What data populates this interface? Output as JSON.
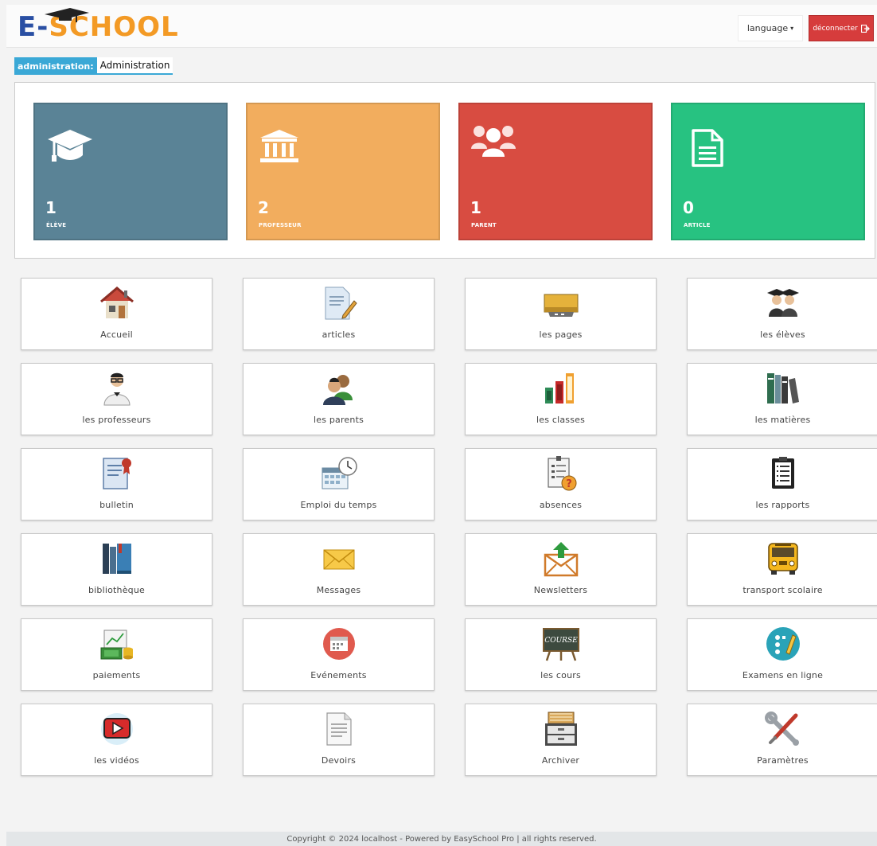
{
  "header": {
    "logo_e": "E-",
    "logo_rest": "SCHOOL",
    "language_label": "language",
    "logout_label": "déconnecter"
  },
  "breadcrumb": {
    "tag": "administration:",
    "current": "Administration"
  },
  "stats": [
    {
      "value": "1",
      "label": "ÉLÈVE",
      "color": "#5a8396",
      "icon": "graduation-cap-icon"
    },
    {
      "value": "2",
      "label": "PROFESSEUR",
      "color": "#f2ad5e",
      "icon": "institution-icon"
    },
    {
      "value": "1",
      "label": "PARENT",
      "color": "#d84c41",
      "icon": "users-icon"
    },
    {
      "value": "0",
      "label": "ARTICLE",
      "color": "#27c281",
      "icon": "document-icon"
    }
  ],
  "tiles": [
    {
      "label": "Accueil",
      "icon": "home-icon"
    },
    {
      "label": "articles",
      "icon": "article-icon"
    },
    {
      "label": "les pages",
      "icon": "pages-icon"
    },
    {
      "label": "les élèves",
      "icon": "students-icon"
    },
    {
      "label": "les professeurs",
      "icon": "teacher-icon"
    },
    {
      "label": "les parents",
      "icon": "parents-icon"
    },
    {
      "label": "les classes",
      "icon": "classes-icon"
    },
    {
      "label": "les matières",
      "icon": "subjects-icon"
    },
    {
      "label": "bulletin",
      "icon": "certificate-icon"
    },
    {
      "label": "Emploi du temps",
      "icon": "schedule-icon"
    },
    {
      "label": "absences",
      "icon": "absences-icon"
    },
    {
      "label": "les rapports",
      "icon": "reports-icon"
    },
    {
      "label": "bibliothèque",
      "icon": "library-icon"
    },
    {
      "label": "Messages",
      "icon": "envelope-icon"
    },
    {
      "label": "Newsletters",
      "icon": "newsletter-icon"
    },
    {
      "label": "transport scolaire",
      "icon": "bus-icon"
    },
    {
      "label": "paiements",
      "icon": "payments-icon"
    },
    {
      "label": "Evénements",
      "icon": "calendar-icon"
    },
    {
      "label": "les cours",
      "icon": "course-board-icon"
    },
    {
      "label": "Examens en ligne",
      "icon": "exam-icon"
    },
    {
      "label": "les vidéos",
      "icon": "video-icon"
    },
    {
      "label": "Devoirs",
      "icon": "homework-icon"
    },
    {
      "label": "Archiver",
      "icon": "archive-icon"
    },
    {
      "label": "Paramètres",
      "icon": "tools-icon"
    }
  ],
  "course_board_text": "COURSE",
  "footer": {
    "text": "Copyright © 2024 localhost - Powered by EasySchool Pro | all rights reserved."
  }
}
